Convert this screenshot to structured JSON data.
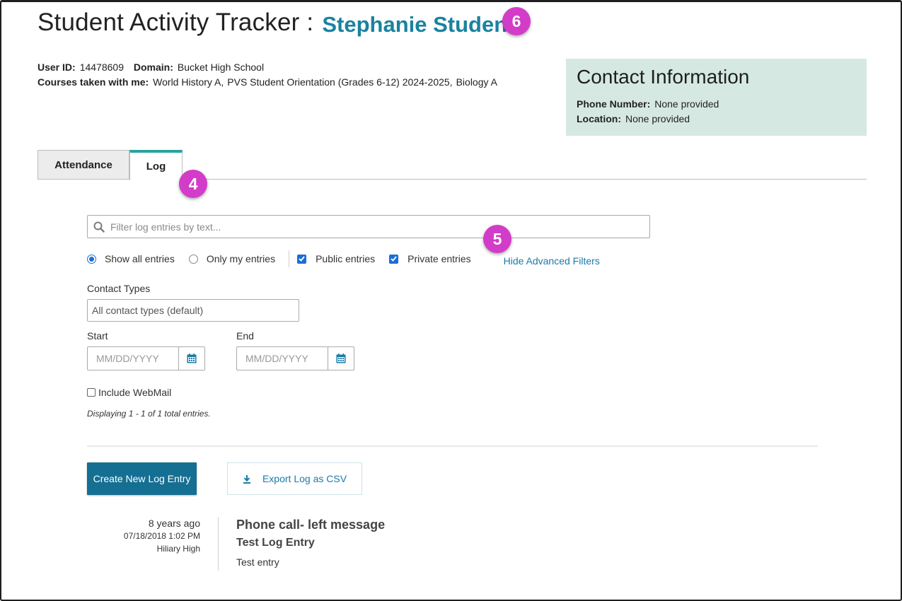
{
  "header": {
    "title": "Student Activity Tracker :",
    "student_name": "Stephanie Student"
  },
  "annotations": {
    "badge_name": "6",
    "badge_tabs": "4",
    "badge_filters": "5"
  },
  "student_info": {
    "user_id_label": "User ID:",
    "user_id": "14478609",
    "domain_label": "Domain:",
    "domain": "Bucket High School",
    "courses_label": "Courses taken with me:",
    "courses": [
      "World History A,",
      "PVS Student Orientation (Grades 6-12) 2024-2025,",
      "Biology A"
    ]
  },
  "contact": {
    "title": "Contact Information",
    "phone_label": "Phone Number:",
    "phone": "None provided",
    "location_label": "Location:",
    "location": "None provided"
  },
  "tabs": {
    "attendance": "Attendance",
    "log": "Log",
    "active": "log"
  },
  "filters": {
    "search_placeholder": "Filter log entries by text...",
    "show_all": "Show all entries",
    "only_mine": "Only my entries",
    "public_entries": "Public entries",
    "private_entries": "Private entries",
    "hide_advanced": "Hide Advanced Filters",
    "contact_types_label": "Contact Types",
    "contact_types_value": "All contact types (default)",
    "start_label": "Start",
    "end_label": "End",
    "date_placeholder": "MM/DD/YYYY",
    "include_webmail": "Include WebMail",
    "displaying": "Displaying 1 - 1 of 1 total entries."
  },
  "actions": {
    "create": "Create New Log Entry",
    "export": "Export Log as CSV"
  },
  "entries": [
    {
      "ago": "8 years ago",
      "datetime": "07/18/2018 1:02 PM",
      "author": "Hiliary High",
      "type": "Phone call- left message",
      "subject": "Test Log Entry",
      "text": "Test entry"
    }
  ],
  "colors": {
    "accent": "#1a82a0",
    "badge": "#d33cc8",
    "contact_bg": "#d5e9e2",
    "primary_button": "#156f93",
    "tab_indicator": "#29a29c"
  }
}
